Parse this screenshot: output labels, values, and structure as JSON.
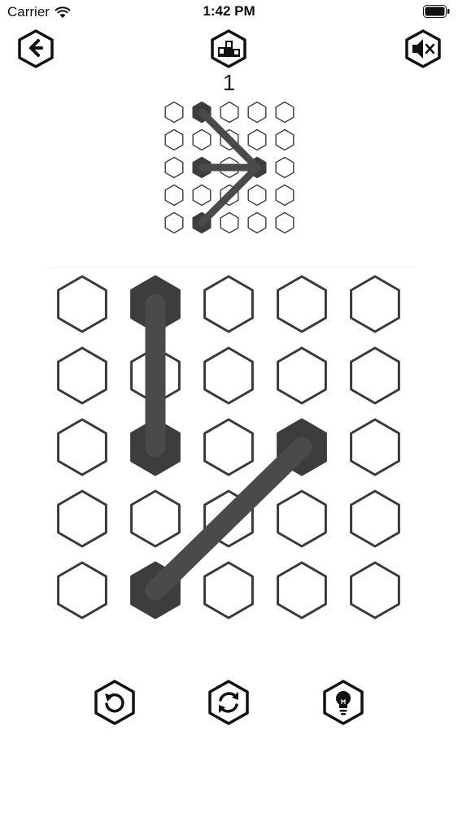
{
  "status_bar": {
    "carrier": "Carrier",
    "time": "1:42 PM"
  },
  "level": {
    "number": "1"
  },
  "colors": {
    "filled": "#3d3d3d",
    "line": "#4a4a4a",
    "outline": "#3a3a3a",
    "icon": "#111111"
  },
  "icons": {
    "back": "back-arrow-icon",
    "leaderboard": "podium-icon",
    "sound": "speaker-muted-icon",
    "undo": "undo-icon",
    "restart": "restart-icon",
    "hint": "lightbulb-icon"
  },
  "target_pattern": {
    "rows": 5,
    "cols": 5,
    "filled": [
      [
        0,
        1
      ],
      [
        2,
        1
      ],
      [
        2,
        3
      ],
      [
        4,
        1
      ]
    ],
    "lines": [
      [
        [
          0,
          1
        ],
        [
          2,
          3
        ]
      ],
      [
        [
          2,
          1
        ],
        [
          2,
          3
        ]
      ],
      [
        [
          4,
          1
        ],
        [
          2,
          3
        ]
      ]
    ]
  },
  "player_board": {
    "rows": 5,
    "cols": 5,
    "filled": [
      [
        0,
        1
      ],
      [
        2,
        1
      ],
      [
        2,
        3
      ],
      [
        4,
        1
      ]
    ],
    "lines": [
      [
        [
          0,
          1
        ],
        [
          2,
          1
        ]
      ],
      [
        [
          4,
          1
        ],
        [
          2,
          3
        ]
      ]
    ]
  }
}
